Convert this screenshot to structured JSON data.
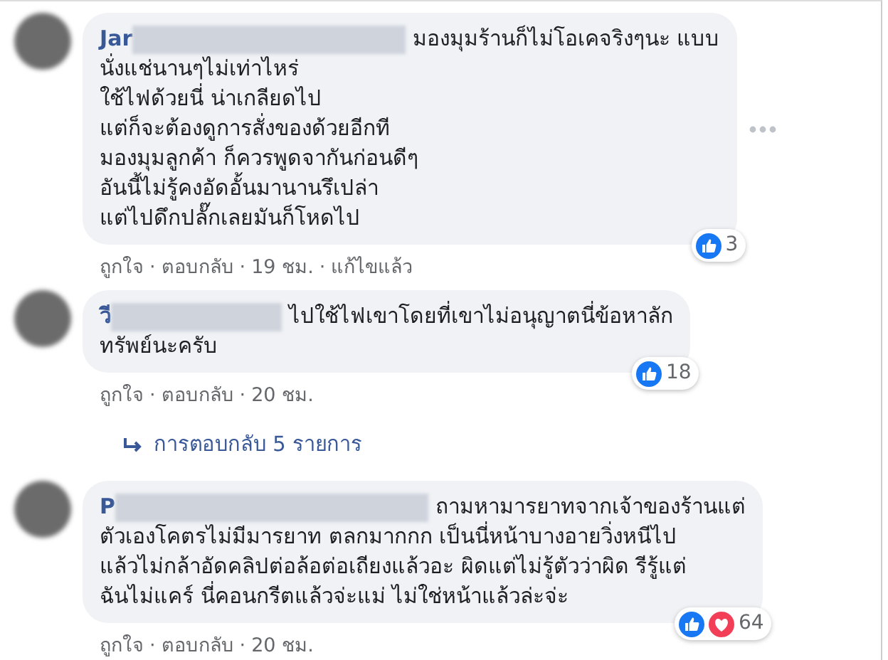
{
  "separator": "·",
  "comments": [
    {
      "name": "Jar",
      "text": "มองมุมร้านก็ไม่โอเคจริงๆนะ แบบ\nนั่งแช่นานๆไม่เท่าไหร่\nใช้ไฟด้วยนี่ น่าเกลียดไป\nแต่ก็จะต้องดูการสั่งของด้วยอีกที\nมองมุมลูกค้า ก็ควรพูดจากันก่อนดีๆ\nอันนี้ไม่รู้คงอัดอั้นมานานรึเปล่า\nแต่ไปดึกปลั๊กเลยมันก็โหดไป",
      "has_menu": true,
      "reactions": {
        "like": true,
        "love": false,
        "count": "3"
      },
      "meta": [
        "ถูกใจ",
        "ตอบกลับ",
        "19 ชม.",
        "แก้ไขแล้ว"
      ]
    },
    {
      "name": "วี",
      "text": "ไปใช้ไฟเขาโดยที่เขาไม่อนุญาตนี่ข้อหาลัก\nทรัพย์นะครับ",
      "has_menu": false,
      "reactions": {
        "like": true,
        "love": false,
        "count": "18"
      },
      "meta": [
        "ถูกใจ",
        "ตอบกลับ",
        "20 ชม."
      ],
      "replies_link": "การตอบกลับ 5 รายการ"
    },
    {
      "name": "P",
      "text": "ถามหามารยาทจากเจ้าของร้านแต่\nตัวเองโคตรไม่มีมารยาท ตลกมากกก เป็นนี่หน้าบางอายวิ่งหนีไป\nแล้วไม่กล้าอัดคลิปต่อล้อต่อเถียงแล้วอะ ผิดแต่ไม่รู้ตัวว่าผิด รีรู้แต่\nฉันไม่แคร์ นี่คอนกรีตแล้วจ่ะแม่ ไม่ใช่หน้าแล้วล่ะจ่ะ",
      "has_menu": false,
      "reactions": {
        "like": true,
        "love": true,
        "count": "64"
      },
      "meta": [
        "ถูกใจ",
        "ตอบกลับ",
        "20 ชม."
      ]
    }
  ]
}
